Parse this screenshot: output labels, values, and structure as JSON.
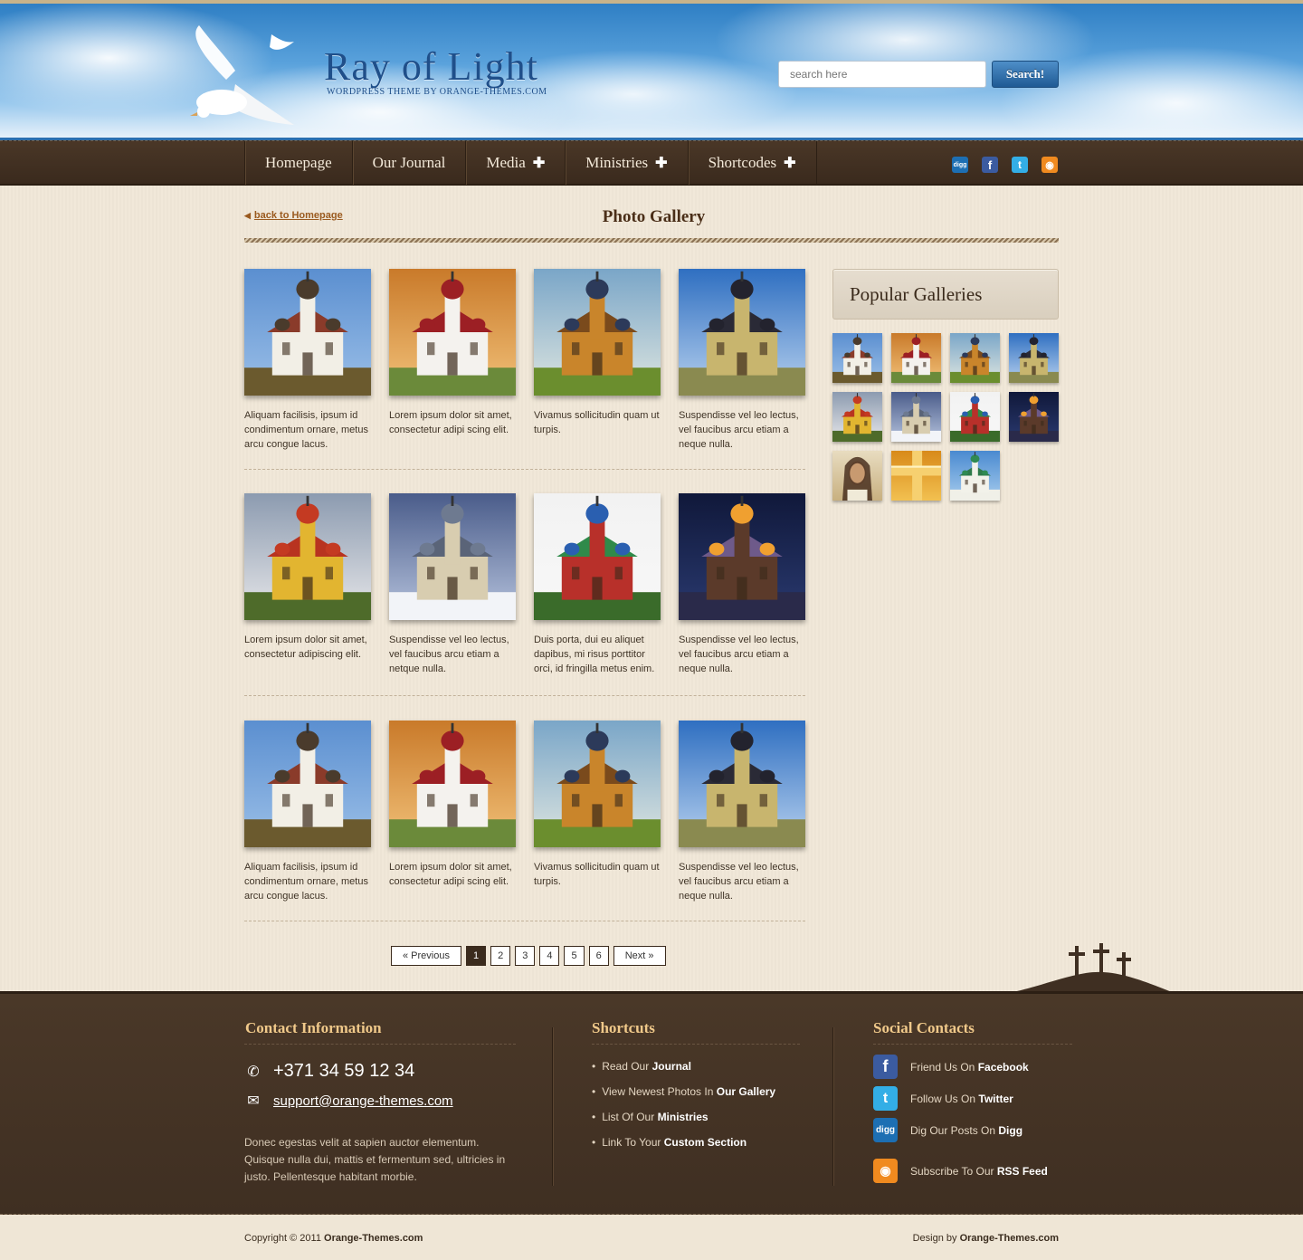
{
  "header": {
    "logo_title": "Ray of Light",
    "logo_subtitle": "WORDPRESS THEME BY ORANGE-THEMES.COM",
    "search_placeholder": "search here",
    "search_button": "Search!"
  },
  "nav": {
    "items": [
      {
        "label": "Homepage",
        "submenu": false
      },
      {
        "label": "Our Journal",
        "submenu": false
      },
      {
        "label": "Media",
        "submenu": true
      },
      {
        "label": "Ministries",
        "submenu": true
      },
      {
        "label": "Shortcodes",
        "submenu": true
      }
    ],
    "social_icons": [
      "digg-icon",
      "facebook-icon",
      "twitter-icon",
      "rss-icon"
    ]
  },
  "page": {
    "back_link": "back to Homepage",
    "title": "Photo Gallery"
  },
  "gallery": [
    {
      "caption": "Aliquam facilisis, ipsum id condimentum ornare, metus arcu congue lacus.",
      "image": "church-lake"
    },
    {
      "caption": "Lorem ipsum dolor sit amet, consectetur adipi scing elit.",
      "image": "white-red-dome-church"
    },
    {
      "caption": "Vivamus sollicitudin quam ut turpis.",
      "image": "wooden-church"
    },
    {
      "caption": "Suspendisse vel leo lectus, vel faucibus arcu etiam a neque nulla.",
      "image": "black-domes-church"
    },
    {
      "caption": "Lorem ipsum dolor sit amet, consectetur adipiscing elit.",
      "image": "yellow-cathedral"
    },
    {
      "caption": "Suspendisse vel leo lectus, vel faucibus arcu etiam a netque nulla.",
      "image": "church-winter"
    },
    {
      "caption": "Duis porta, dui eu aliquet dapibus, mi risus porttitor orci, id fringilla metus enim.",
      "image": "onion-domes"
    },
    {
      "caption": "Suspendisse vel leo lectus, vel faucibus arcu etiam a neque nulla.",
      "image": "night-church"
    },
    {
      "caption": "Aliquam facilisis, ipsum id condimentum ornare, metus arcu congue lacus.",
      "image": "church-lake"
    },
    {
      "caption": "Lorem ipsum dolor sit amet, consectetur adipi scing elit.",
      "image": "white-red-dome-church"
    },
    {
      "caption": "Vivamus sollicitudin quam ut turpis.",
      "image": "wooden-church"
    },
    {
      "caption": "Suspendisse vel leo lectus, vel faucibus arcu etiam a neque nulla.",
      "image": "black-domes-church"
    }
  ],
  "sidebar": {
    "title": "Popular Galleries",
    "thumbs": [
      "church-lake",
      "white-red-dome-church",
      "wooden-church",
      "black-domes-church",
      "yellow-cathedral",
      "church-winter",
      "onion-domes",
      "night-church",
      "jesus-portrait",
      "golden-cross",
      "green-domes"
    ]
  },
  "pagination": {
    "prev": "« Previous",
    "pages": [
      "1",
      "2",
      "3",
      "4",
      "5",
      "6"
    ],
    "current": "1",
    "next": "Next »"
  },
  "footer": {
    "contact": {
      "title": "Contact Information",
      "phone": "+371 34 59 12 34",
      "email": "support@orange-themes.com",
      "description": "Donec egestas velit at sapien auctor elementum. Quisque nulla dui, mattis et fermentum sed, ultricies in justo. Pellentesque habitant morbie."
    },
    "shortcuts": {
      "title": "Shortcuts",
      "items": [
        {
          "prefix": "Read Our",
          "bold": "Journal"
        },
        {
          "prefix": "View Newest Photos In",
          "bold": "Our Gallery"
        },
        {
          "prefix": "List Of Our",
          "bold": "Ministries"
        },
        {
          "prefix": "Link To Your",
          "bold": "Custom Section"
        }
      ]
    },
    "social": {
      "title": "Social Contacts",
      "items": [
        {
          "prefix": "Friend Us On",
          "bold": "Facebook",
          "icon": "facebook-icon"
        },
        {
          "prefix": "Follow Us On",
          "bold": "Twitter",
          "icon": "twitter-icon"
        },
        {
          "prefix": "Dig Our Posts On",
          "bold": "Digg",
          "icon": "digg-icon"
        },
        {
          "prefix": "Subscribe To Our",
          "bold": "RSS Feed",
          "icon": "rss-icon"
        }
      ]
    }
  },
  "bottom": {
    "copyright_prefix": "Copyright © 2011",
    "copyright_site": "Orange-Themes.com",
    "credit_prefix": "Design by",
    "credit_site": "Orange-Themes.com"
  },
  "colors": {
    "brown_dark": "#3f2f22",
    "accent_gold": "#f0c98a",
    "link_orange": "#9a5a1f",
    "sky_blue": "#2f7fc4"
  }
}
